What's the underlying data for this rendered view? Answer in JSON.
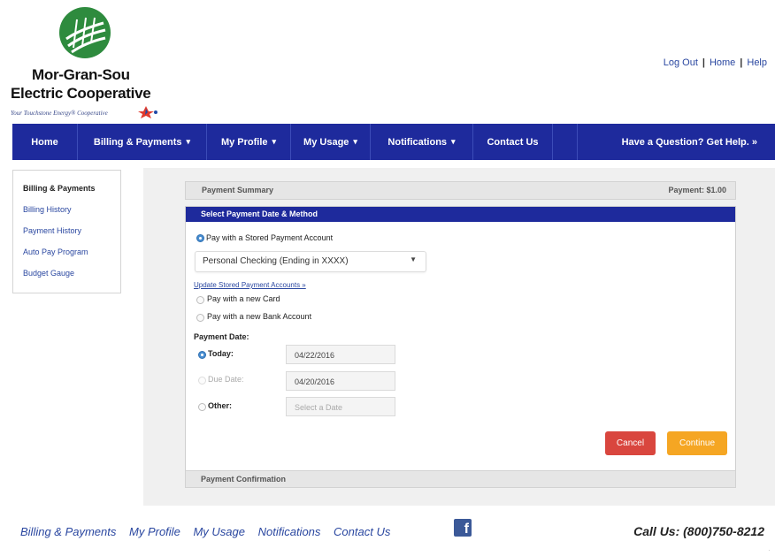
{
  "brand": {
    "name_line1": "Mor-Gran-Sou",
    "name_line2": "Electric Cooperative",
    "tagline": "Your Touchstone Energy® Cooperative"
  },
  "top_links": {
    "logout": "Log Out",
    "home": "Home",
    "help": "Help"
  },
  "nav": {
    "items": [
      {
        "label": "Home"
      },
      {
        "label": "Billing & Payments",
        "caret": "▾"
      },
      {
        "label": "My Profile",
        "caret": "▾"
      },
      {
        "label": "My Usage",
        "caret": "▾"
      },
      {
        "label": "Notifications",
        "caret": "▾"
      },
      {
        "label": "Contact Us"
      }
    ],
    "help": "Have a Question? Get Help. »"
  },
  "sidebar": {
    "title": "Billing & Payments",
    "links": [
      "Billing History",
      "Payment History",
      "Auto Pay Program",
      "Budget Gauge"
    ]
  },
  "summary": {
    "label": "Payment Summary",
    "amount": "Payment: $1.00"
  },
  "method_panel": {
    "header": "Select Payment Date & Method",
    "stored_option": "Pay with a Stored Payment Account",
    "stored_selected": "Personal Checking (Ending in XXXX)",
    "update_link": "Update Stored Payment Accounts »",
    "new_card_option": "Pay with a new Card",
    "new_bank_option": "Pay with a new Bank Account",
    "date_heading": "Payment Date:",
    "today_label": "Today:",
    "today_value": "04/22/2016",
    "due_label": "Due Date:",
    "due_value": "04/20/2016",
    "other_label": "Other:",
    "other_placeholder": "Select a Date",
    "cancel": "Cancel",
    "continue": "Continue"
  },
  "confirmation": {
    "label": "Payment Confirmation"
  },
  "footer": {
    "links": [
      "Billing & Payments",
      "My Profile",
      "My Usage",
      "Notifications",
      "Contact Us"
    ],
    "facebook_icon": "f",
    "call_us": "Call Us: (800)750-8212"
  },
  "colors": {
    "nav": "#1e2a9c",
    "link": "#2a47a0",
    "cancel": "#d9463e",
    "continue": "#f5a623",
    "logo": "#2e8b3e"
  }
}
